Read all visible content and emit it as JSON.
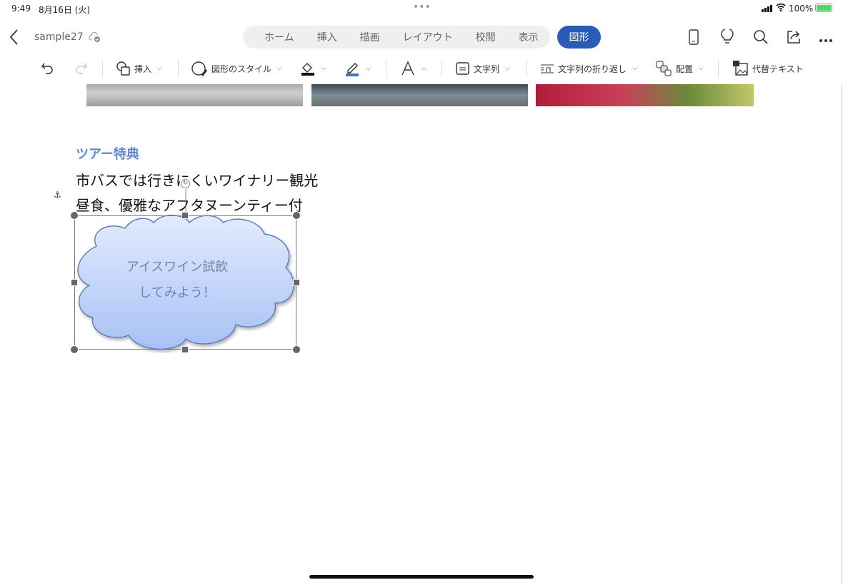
{
  "status_bar": {
    "time": "9:49",
    "date": "8月16日 (火)",
    "battery": "100%",
    "dots": "•••"
  },
  "document": {
    "title": "sample27",
    "back_icon": "chevron-left-icon",
    "cloud_icon": "cloud-saved-icon"
  },
  "tabs": [
    {
      "label": "ホーム"
    },
    {
      "label": "挿入"
    },
    {
      "label": "描画"
    },
    {
      "label": "レイアウト"
    },
    {
      "label": "校閲"
    },
    {
      "label": "表示"
    }
  ],
  "active_tab": {
    "label": "図形",
    "color": "#2b5bb8"
  },
  "right_icons": [
    "phone-view-icon",
    "lightbulb-icon",
    "search-icon",
    "share-icon",
    "more-icon"
  ],
  "toolbar": {
    "insert": "挿入",
    "shape_style": "図形のスタイル",
    "text": "文字列",
    "wrap": "文字列の折り返し",
    "arrange": "配置",
    "alt_text": "代替テキスト"
  },
  "content": {
    "heading": "ツアー特典",
    "line1": "市バスでは行きにくいワイナリー観光",
    "line2": "昼食、優雅なアフタヌーンティー付",
    "cloud_line1": "アイスワイン試飲",
    "cloud_line2": "してみよう！",
    "heading_color": "#5b8bd6"
  }
}
